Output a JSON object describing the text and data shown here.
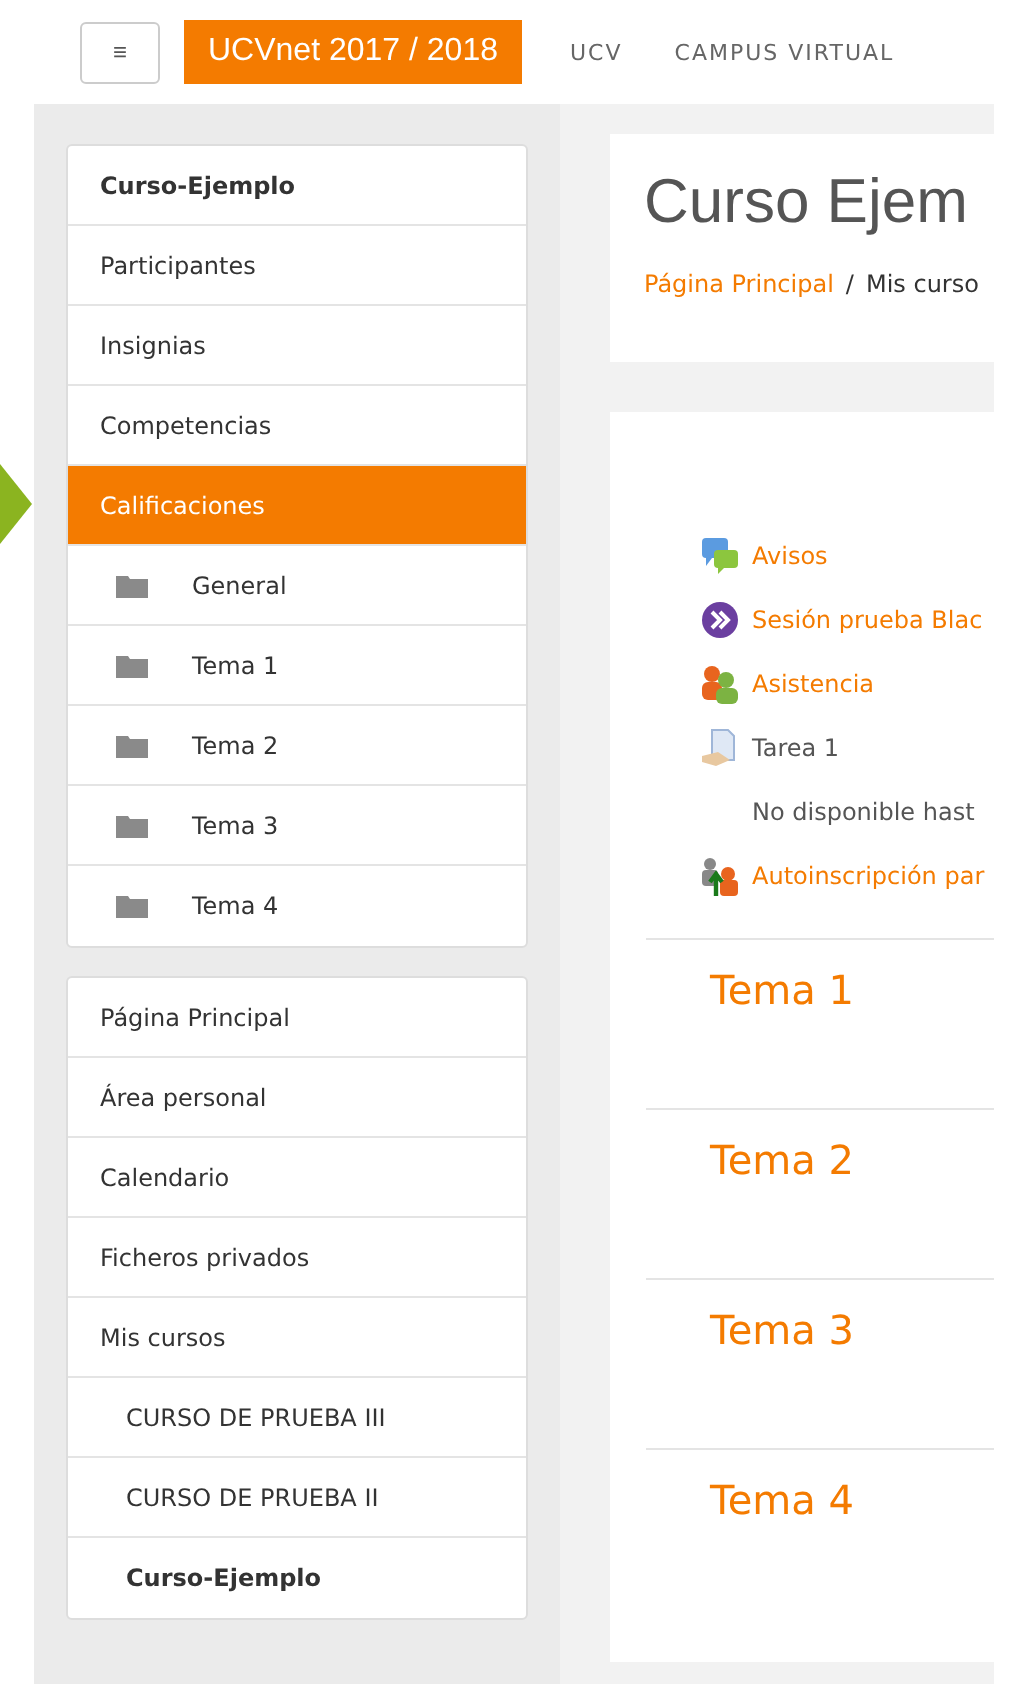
{
  "header": {
    "menu_glyph": "≡",
    "brand": "UCVnet 2017 / 2018",
    "links": [
      "UCV",
      "CAMPUS VIRTUAL"
    ]
  },
  "course_nav": [
    {
      "kind": "heading",
      "label": "Curso-Ejemplo",
      "selected": false
    },
    {
      "kind": "item",
      "label": "Participantes",
      "selected": false
    },
    {
      "kind": "item",
      "label": "Insignias",
      "selected": false
    },
    {
      "kind": "item",
      "label": "Competencias",
      "selected": false
    },
    {
      "kind": "item",
      "label": "Calificaciones",
      "selected": true
    },
    {
      "kind": "folder",
      "label": "General",
      "selected": false
    },
    {
      "kind": "folder",
      "label": "Tema 1",
      "selected": false
    },
    {
      "kind": "folder",
      "label": "Tema 2",
      "selected": false
    },
    {
      "kind": "folder",
      "label": "Tema 3",
      "selected": false
    },
    {
      "kind": "folder",
      "label": "Tema 4",
      "selected": false
    }
  ],
  "site_nav": [
    {
      "kind": "item",
      "label": "Página Principal"
    },
    {
      "kind": "item",
      "label": "Área personal"
    },
    {
      "kind": "item",
      "label": "Calendario"
    },
    {
      "kind": "item",
      "label": "Ficheros privados"
    },
    {
      "kind": "item",
      "label": "Mis cursos"
    },
    {
      "kind": "sub",
      "label": "CURSO DE PRUEBA III"
    },
    {
      "kind": "sub",
      "label": "CURSO DE PRUEBA II"
    },
    {
      "kind": "current",
      "label": "Curso-Ejemplo"
    }
  ],
  "page_title": "Curso Ejem",
  "breadcrumb": [
    "Página Principal",
    "Mis curso"
  ],
  "breadcrumb_separator": "/",
  "activities": [
    {
      "kind": "forum",
      "label": "Avisos",
      "link": true
    },
    {
      "kind": "session",
      "label": "Sesión prueba Blac",
      "link": true
    },
    {
      "kind": "attendance",
      "label": "Asistencia",
      "link": true
    },
    {
      "kind": "assignment",
      "label": "Tarea 1",
      "link": false
    },
    {
      "kind": "note",
      "label": "No disponible hast",
      "link": false
    },
    {
      "kind": "enrol",
      "label": "Autoinscripción par",
      "link": true
    }
  ],
  "sections": [
    "Tema 1",
    "Tema 2",
    "Tema 3",
    "Tema 4"
  ]
}
